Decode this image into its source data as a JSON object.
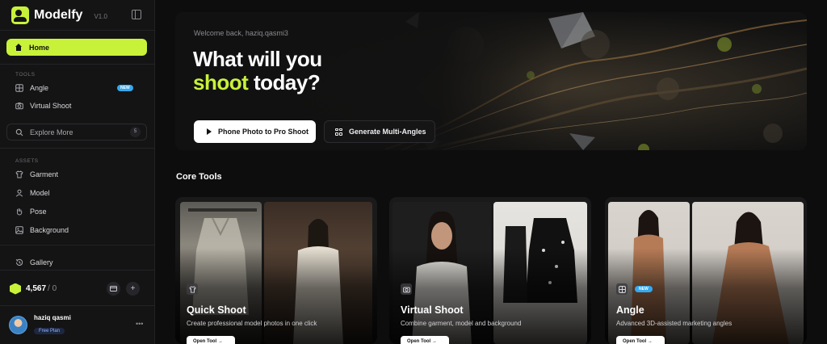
{
  "app": {
    "name": "Modelfy",
    "version": "V1.0"
  },
  "sidebar": {
    "home_label": "Home",
    "tools_label": "TOOLS",
    "tools": [
      {
        "label": "Angle",
        "badge": "NEW",
        "icon": "grid-icon"
      },
      {
        "label": "Virtual Shoot",
        "icon": "camera-icon"
      }
    ],
    "explore": {
      "label": "Explore More",
      "count": "5"
    },
    "assets_label": "ASSETS",
    "assets": [
      {
        "label": "Garment",
        "icon": "shirt-icon"
      },
      {
        "label": "Model",
        "icon": "user-icon"
      },
      {
        "label": "Pose",
        "icon": "hand-icon"
      },
      {
        "label": "Background",
        "icon": "image-icon"
      }
    ],
    "gallery_label": "Gallery",
    "credits": {
      "balance": "4,567",
      "separator": "/ 0"
    },
    "user": {
      "name": "haziq qasmi",
      "plan": "Free Plan"
    }
  },
  "hero": {
    "welcome": "Welcome back, haziq.qasmi3",
    "headline_line1": "What will you",
    "headline_accent": "shoot",
    "headline_rest": " today?",
    "primary_button": "Phone Photo to Pro Shoot",
    "secondary_button": "Generate Multi-Angles"
  },
  "core_tools": {
    "title": "Core Tools",
    "cards": [
      {
        "title": "Quick Shoot",
        "description": "Create professional model photos in one click",
        "button": "Open Tool →",
        "icon": "shirt-icon"
      },
      {
        "title": "Virtual Shoot",
        "description": "Combine garment, model and background",
        "button": "Open Tool →",
        "icon": "camera-icon"
      },
      {
        "title": "Angle",
        "description": "Advanced 3D-assisted marketing angles",
        "button": "Open Tool →",
        "icon": "grid-icon",
        "badge": "NEW"
      }
    ]
  },
  "colors": {
    "accent": "#c8f23a",
    "badge": "#34a9f0",
    "background": "#0d0d0e",
    "sidebar": "#141415"
  }
}
